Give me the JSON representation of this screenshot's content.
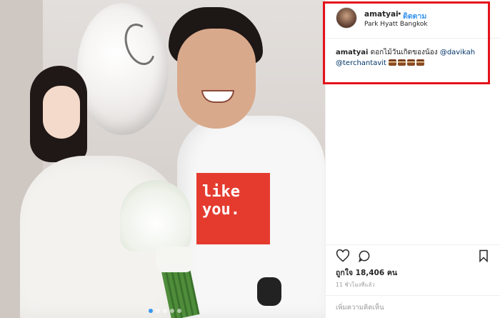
{
  "post": {
    "username": "amatyai",
    "bullet": "•",
    "follow_label": "ติดตาม",
    "location": "Park Hyatt Bangkok",
    "caption": {
      "username": "amatyai",
      "text": "ดอกไม้วันเกิดของน้อง",
      "mention1": "@davikah",
      "mention2": "@terchantavit",
      "emoji_icons": [
        "cake-emoji",
        "cake-emoji",
        "cake-emoji",
        "cake-emoji"
      ]
    },
    "shirt_text": "like you.",
    "likes_text": "ถูกใจ 18,406 คน",
    "timestamp": "11 ชั่วโมงที่แล้ว",
    "comment_placeholder": "เพิ่มความคิดเห็น",
    "carousel": {
      "count": 5,
      "active_index": 0
    },
    "actions": [
      "heart-icon",
      "comment-icon",
      "bookmark-icon"
    ]
  },
  "colors": {
    "accent_follow": "#3897f0",
    "highlight_box": "#e4121b",
    "mention": "#003569",
    "text": "#262626",
    "muted": "#999999"
  }
}
